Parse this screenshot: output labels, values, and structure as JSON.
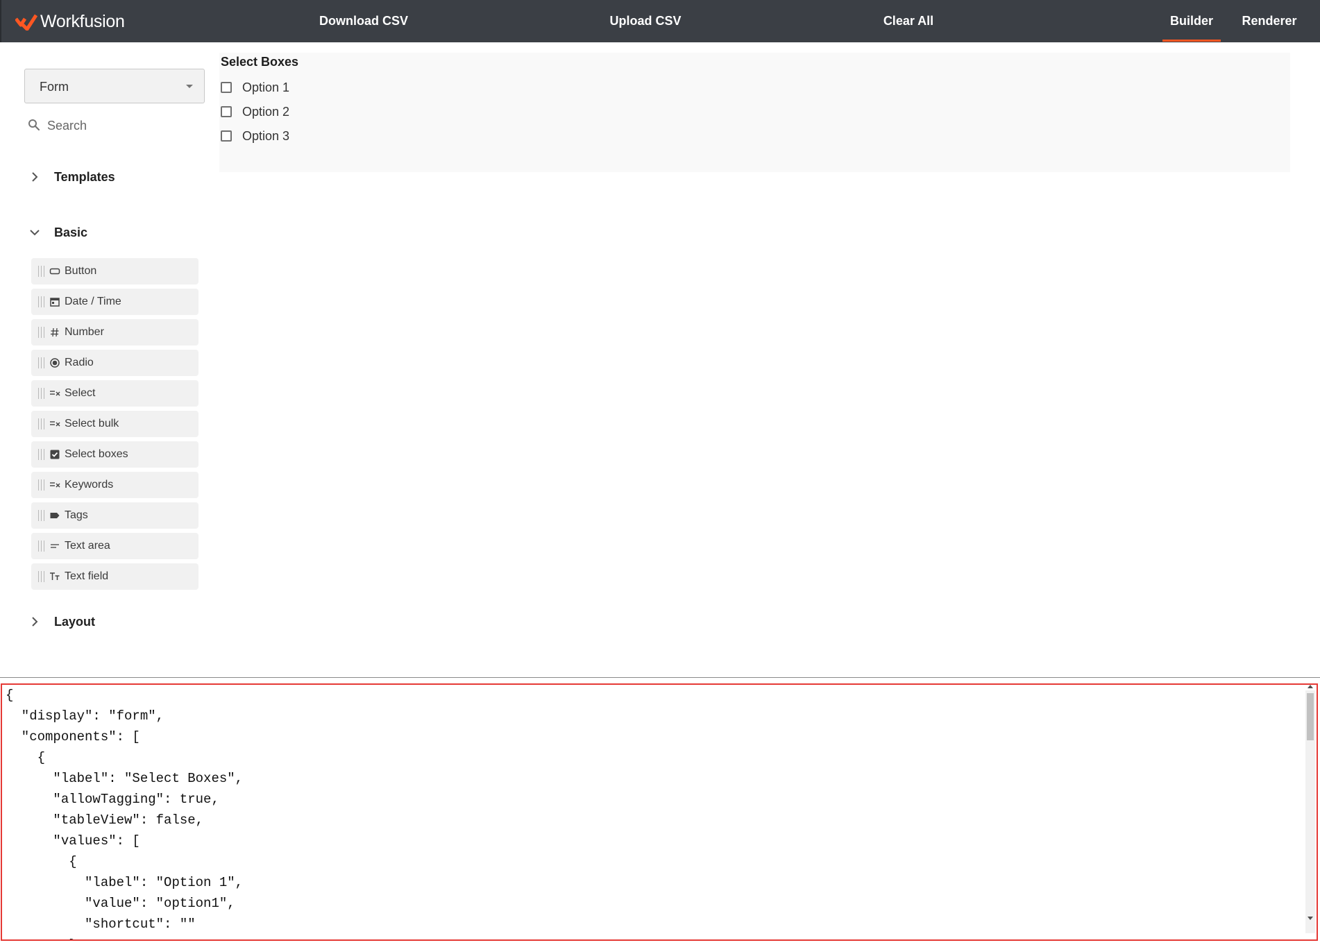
{
  "app": {
    "brand": "Workfusion",
    "accent": "#ff5722",
    "topbar_bg": "#3b3f45"
  },
  "topbar": {
    "download": "Download CSV",
    "upload": "Upload CSV",
    "clear": "Clear All",
    "builder": "Builder",
    "renderer": "Renderer",
    "active_tab": "Builder"
  },
  "sidebar": {
    "display_select": "Form",
    "search_placeholder": "Search",
    "sections": {
      "templates": "Templates",
      "basic": "Basic",
      "layout": "Layout"
    },
    "basic_components": [
      {
        "label": "Button",
        "icon": "button-icon"
      },
      {
        "label": "Date / Time",
        "icon": "calendar-icon"
      },
      {
        "label": "Number",
        "icon": "hash-icon"
      },
      {
        "label": "Radio",
        "icon": "radio-icon"
      },
      {
        "label": "Select",
        "icon": "select-list-icon"
      },
      {
        "label": "Select bulk",
        "icon": "select-list-icon"
      },
      {
        "label": "Select boxes",
        "icon": "checkbox-icon"
      },
      {
        "label": "Keywords",
        "icon": "select-list-icon"
      },
      {
        "label": "Tags",
        "icon": "tag-icon"
      },
      {
        "label": "Text area",
        "icon": "text-lines-icon"
      },
      {
        "label": "Text field",
        "icon": "text-size-icon"
      }
    ]
  },
  "canvas": {
    "title": "Select Boxes",
    "options": [
      "Option 1",
      "Option 2",
      "Option 3"
    ]
  },
  "json_editor": {
    "lines": [
      "{",
      "  \"display\": \"form\",",
      "  \"components\": [",
      "    {",
      "      \"label\": \"Select Boxes\",",
      "      \"allowTagging\": true,",
      "      \"tableView\": false,",
      "      \"values\": [",
      "        {",
      "          \"label\": \"Option 1\",",
      "          \"value\": \"option1\",",
      "          \"shortcut\": \"\"",
      "        },"
    ]
  }
}
